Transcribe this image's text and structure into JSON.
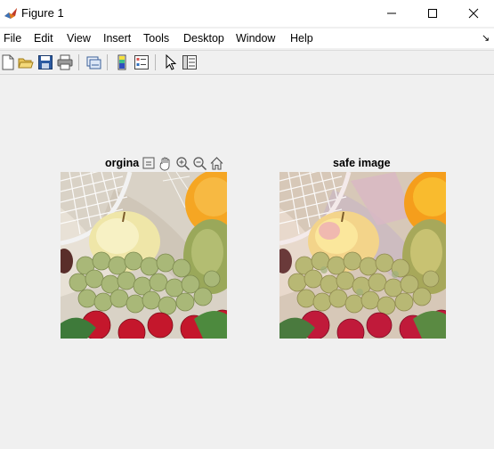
{
  "window": {
    "title": "Figure 1",
    "controls": [
      "minimize",
      "maximize",
      "close"
    ]
  },
  "menu": {
    "items": [
      "File",
      "Edit",
      "View",
      "Insert",
      "Tools",
      "Desktop",
      "Window",
      "Help"
    ],
    "overflow_arrow": "↘"
  },
  "toolbar": {
    "buttons": [
      {
        "icon": "new-figure-icon"
      },
      {
        "icon": "open-file-icon"
      },
      {
        "icon": "save-icon"
      },
      {
        "icon": "print-icon"
      },
      {
        "icon": "link-plot-icon"
      },
      {
        "icon": "insert-colorbar-icon"
      },
      {
        "icon": "insert-legend-icon"
      },
      {
        "icon": "edit-plot-pointer-icon"
      },
      {
        "icon": "open-property-inspector-icon"
      }
    ]
  },
  "axes": [
    {
      "title": "orgina",
      "image": "original fruit photo (grapes, apple, orange)"
    },
    {
      "title": "safe image",
      "image": "posterized fruit photo (grapes, apple, orange)"
    }
  ],
  "axes_toolbar": {
    "icons": [
      "export-icon",
      "pan-hand-icon",
      "zoom-in-icon",
      "zoom-out-icon",
      "home-restore-icon"
    ]
  },
  "colors": {
    "window_bg": "#f0f0f0",
    "titlebar_bg": "#ffffff",
    "accent": "#0072bd"
  }
}
